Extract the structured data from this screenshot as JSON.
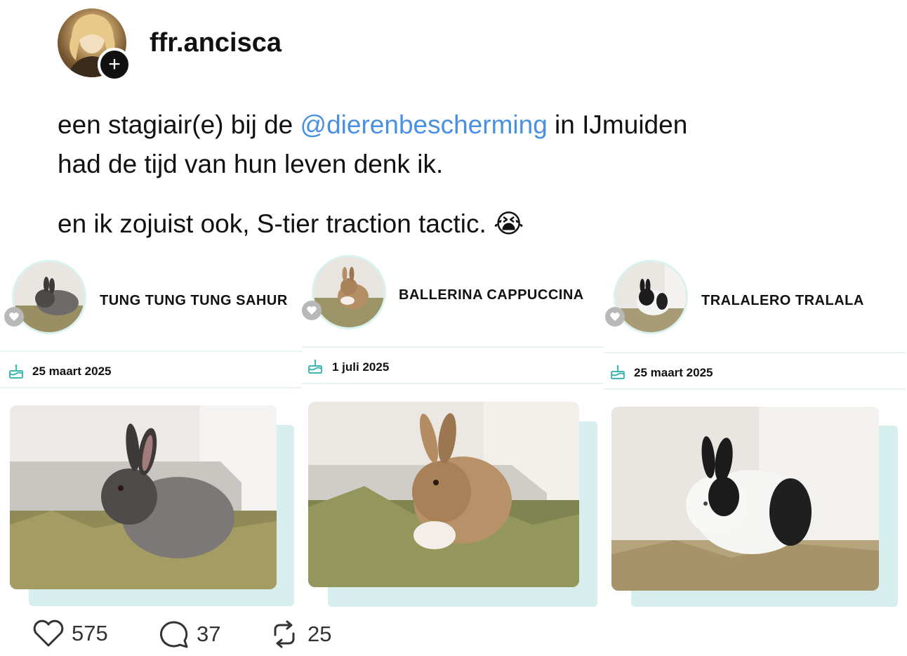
{
  "post": {
    "username": "ffr.ancisca",
    "line1_pre": "een stagiair(e) bij de ",
    "mention": "@dierenbescherming",
    "line1_post": " in IJmuiden",
    "line2": "had de tijd van hun leven denk ik.",
    "line3": "en ik zojuist ook, S-tier traction tactic.",
    "emoji": "😭"
  },
  "cards": [
    {
      "name": "TUNG TUNG TUNG SAHUR",
      "date": "25 maart 2025"
    },
    {
      "name": "BALLERINA CAPPUCCINA",
      "date": "1 juli 2025"
    },
    {
      "name": "TRALALERO TRALALA",
      "date": "25 maart 2025"
    }
  ],
  "actions": {
    "likes": "575",
    "comments": "37",
    "reposts": "25"
  },
  "colors": {
    "mention": "#4a90e2",
    "accent_teal": "#3fb8b0",
    "card_shadow": "#d6efee"
  },
  "icons": [
    "plus-icon",
    "heart-icon",
    "comment-icon",
    "repost-icon",
    "cake-icon"
  ]
}
